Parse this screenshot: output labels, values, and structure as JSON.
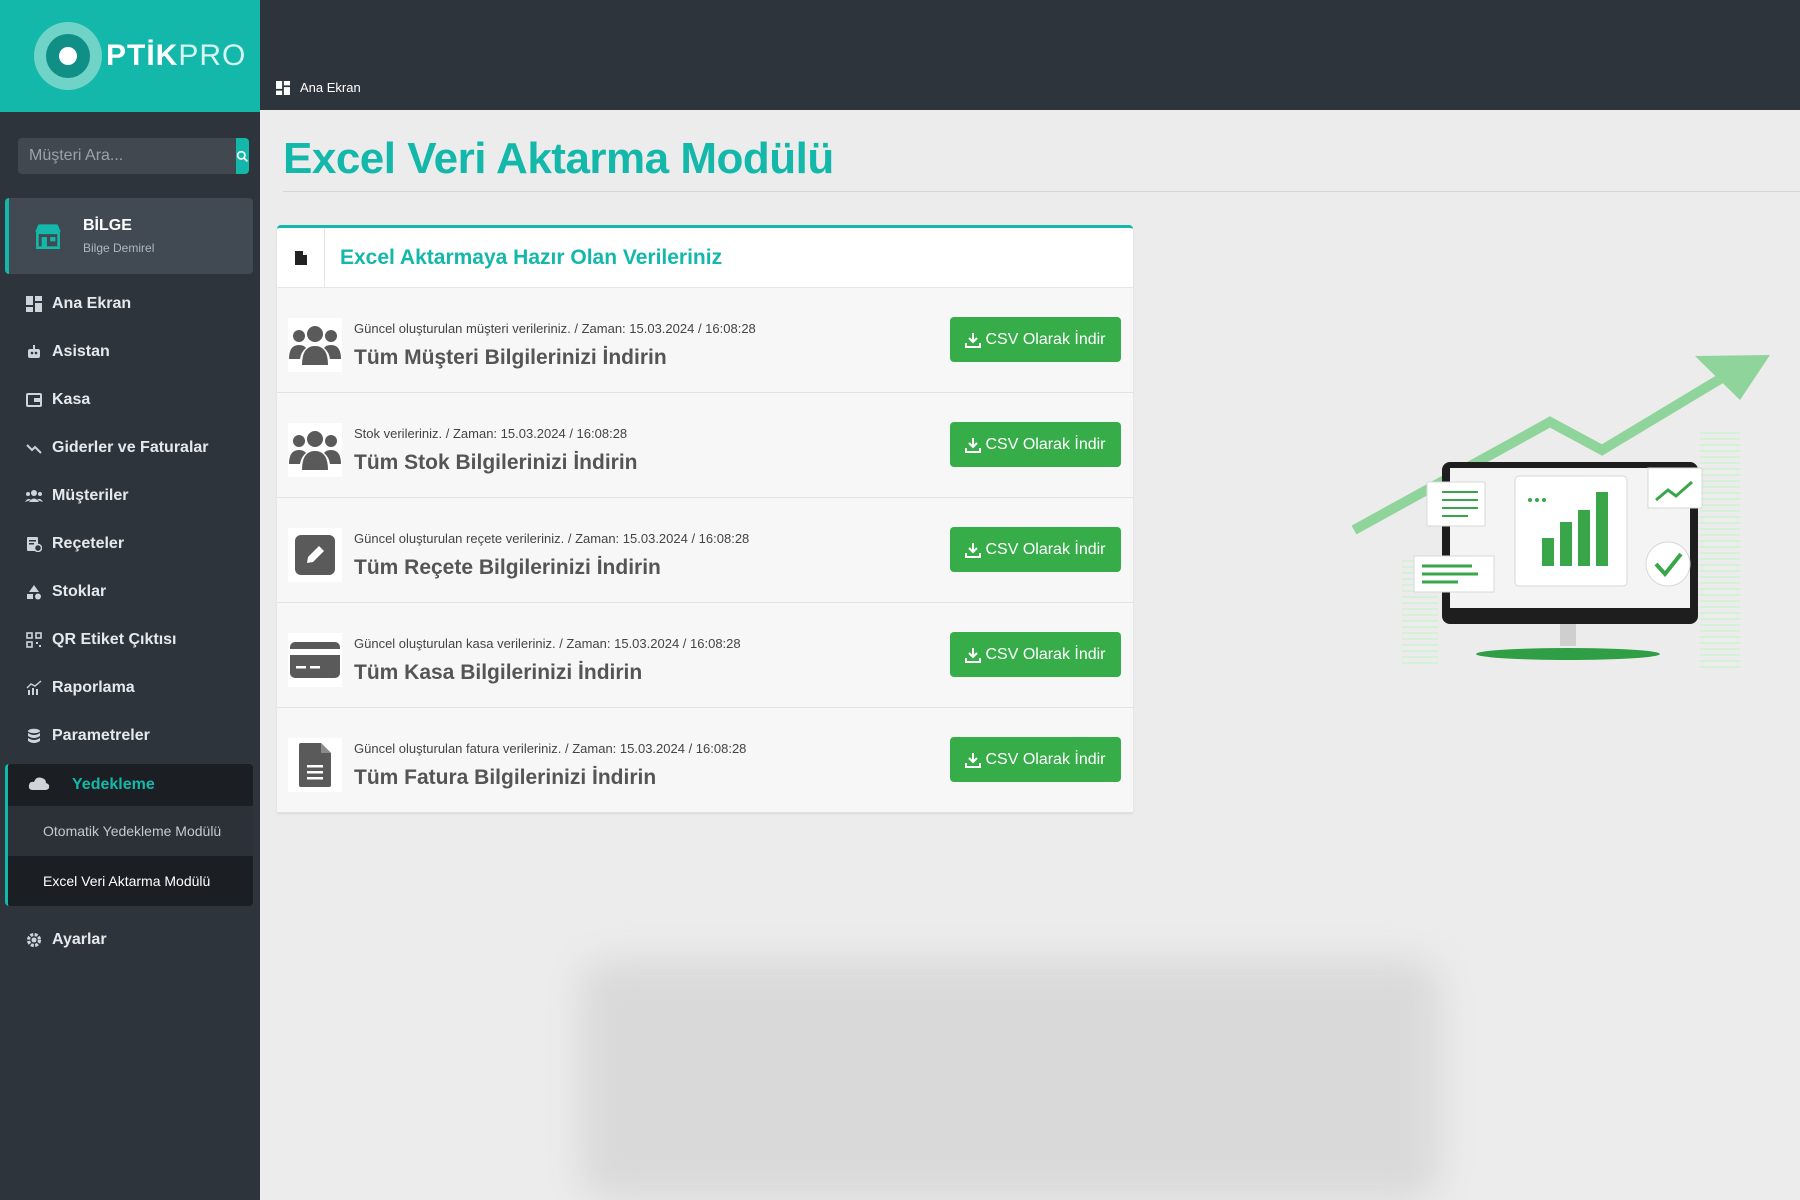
{
  "brand": {
    "logo_bold": "PTİK",
    "logo_light": "PRO"
  },
  "search": {
    "placeholder": "Müşteri Ara..."
  },
  "user": {
    "name": "BİLGE",
    "subtitle": "Bilge Demirel"
  },
  "nav": {
    "items": [
      {
        "label": "Ana Ekran",
        "icon": "dashboard-icon"
      },
      {
        "label": "Asistan",
        "icon": "robot-icon"
      },
      {
        "label": "Kasa",
        "icon": "wallet-icon"
      },
      {
        "label": "Giderler ve Faturalar",
        "icon": "trend-down-icon"
      },
      {
        "label": "Müşteriler",
        "icon": "users-icon"
      },
      {
        "label": "Reçeteler",
        "icon": "prescription-icon"
      },
      {
        "label": "Stoklar",
        "icon": "shapes-icon"
      },
      {
        "label": "QR Etiket Çıktısı",
        "icon": "qr-icon"
      },
      {
        "label": "Raporlama",
        "icon": "chart-icon"
      },
      {
        "label": "Parametreler",
        "icon": "database-icon"
      }
    ],
    "group": {
      "label": "Yedekleme",
      "icon": "cloud-icon",
      "sub_items": [
        {
          "label": "Otomatik Yedekleme Modülü",
          "active": false
        },
        {
          "label": "Excel Veri Aktarma Modülü",
          "active": true
        }
      ]
    },
    "settings": {
      "label": "Ayarlar",
      "icon": "gear-icon"
    }
  },
  "breadcrumb": {
    "label": "Ana Ekran"
  },
  "page": {
    "title": "Excel Veri Aktarma Modülü"
  },
  "card": {
    "title": "Excel Aktarmaya Hazır Olan Verileriniz",
    "button_label": "CSV Olarak İndir",
    "rows": [
      {
        "meta": "Güncel oluşturulan müşteri verileriniz. / Zaman: 15.03.2024 / 16:08:28",
        "title": "Tüm Müşteri Bilgilerinizi İndirin",
        "icon": "users-icon"
      },
      {
        "meta": "Stok verileriniz. / Zaman: 15.03.2024 / 16:08:28",
        "title": "Tüm Stok Bilgilerinizi İndirin",
        "icon": "users-icon"
      },
      {
        "meta": "Güncel oluşturulan reçete verileriniz. / Zaman: 15.03.2024 / 16:08:28",
        "title": "Tüm Reçete Bilgilerinizi İndirin",
        "icon": "edit-icon"
      },
      {
        "meta": "Güncel oluşturulan kasa verileriniz. / Zaman: 15.03.2024 / 16:08:28",
        "title": "Tüm Kasa Bilgilerinizi İndirin",
        "icon": "credit-card-icon"
      },
      {
        "meta": "Güncel oluşturulan fatura verileriniz. / Zaman: 15.03.2024 / 16:08:28",
        "title": "Tüm Fatura Bilgilerinizi İndirin",
        "icon": "file-icon"
      }
    ]
  },
  "colors": {
    "accent": "#14b8aa",
    "sidebar": "#2e343b",
    "button": "#37ad4a",
    "illustration_green": "#4caf50"
  }
}
